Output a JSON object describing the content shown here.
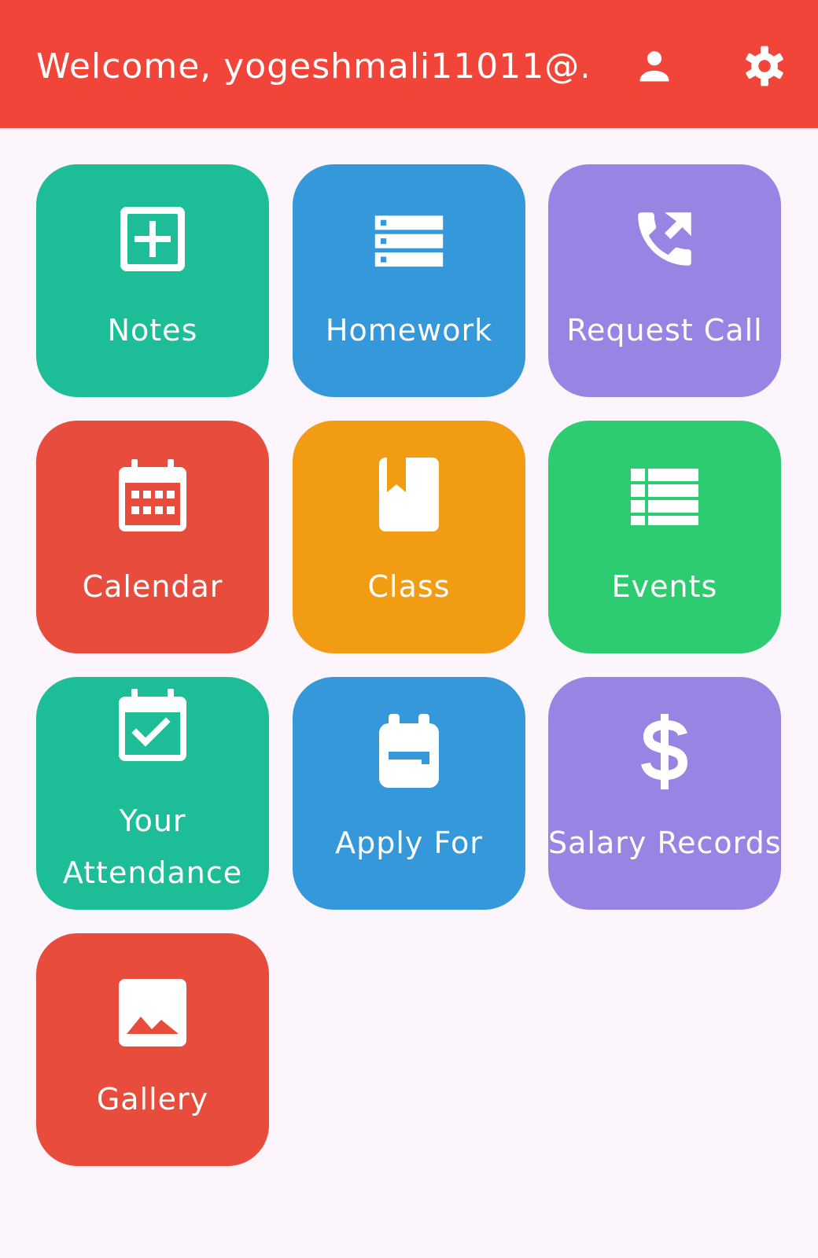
{
  "header": {
    "welcome_text": "Welcome, yogeshmali11011@...",
    "background_color": "#f2453a",
    "profile_icon": "person-icon",
    "settings_icon": "gear-icon"
  },
  "tiles": [
    {
      "label": "Notes",
      "icon": "add-box-icon",
      "color": "#1dbd98"
    },
    {
      "label": "Homework",
      "icon": "list-server-icon",
      "color": "#3498db"
    },
    {
      "label": "Request Call",
      "icon": "phone-callback-icon",
      "color": "#9885e3"
    },
    {
      "label": "Calendar",
      "icon": "calendar-icon",
      "color": "#e74c3c"
    },
    {
      "label": "Class",
      "icon": "book-icon",
      "color": "#f29c13"
    },
    {
      "label": "Events",
      "icon": "list-icon",
      "color": "#2dcc70"
    },
    {
      "label": "Your Attendance",
      "icon": "calendar-check-icon",
      "color": "#1dbd98"
    },
    {
      "label": "Apply For",
      "icon": "backpack-icon",
      "color": "#3498db"
    },
    {
      "label": "Salary Records",
      "icon": "dollar-icon",
      "color": "#9885e3"
    },
    {
      "label": "Gallery",
      "icon": "image-icon",
      "color": "#e74c3c"
    }
  ]
}
